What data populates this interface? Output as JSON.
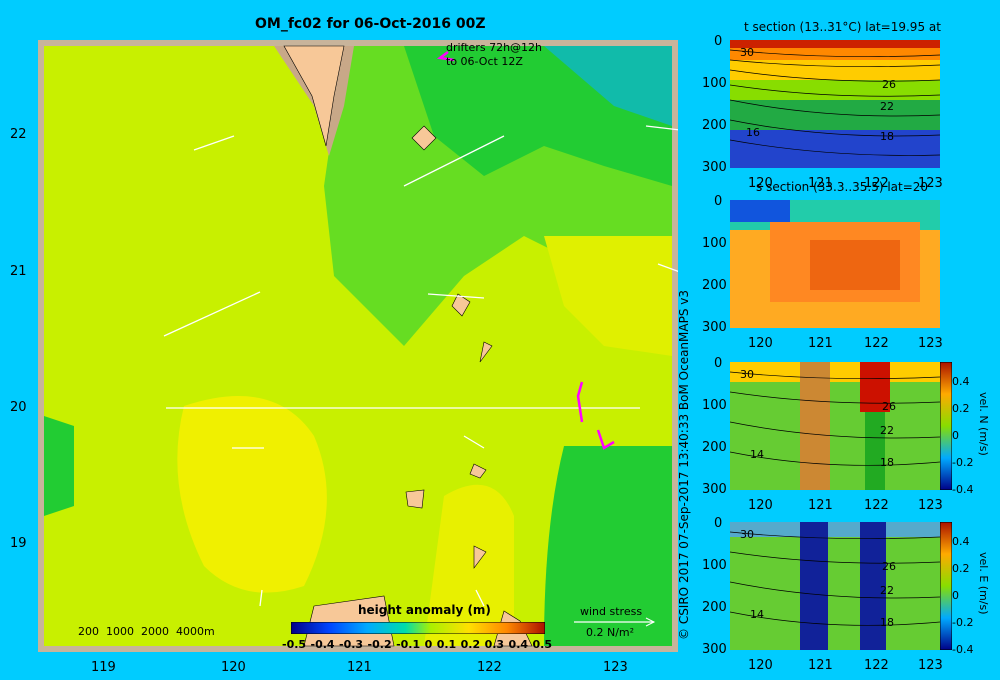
{
  "title": "OM_fc02 for 06-Oct-2016 00Z",
  "drifters": {
    "line1": "drifters 72h@12h",
    "line2": "to 06-Oct 12Z"
  },
  "map": {
    "y_ticks": [
      "22",
      "21",
      "20",
      "19"
    ],
    "x_ticks": [
      "119",
      "120",
      "121",
      "122",
      "123"
    ],
    "depth_legend": "200  1000  2000  4000m",
    "section_line_lat": 20
  },
  "colorbar": {
    "title": "height anomaly (m)",
    "ticks": [
      "-0.5",
      "-0.4",
      "-0.3",
      "-0.2",
      "-0.1",
      "0",
      "0.1",
      "0.2",
      "0.3",
      "0.4",
      "0.5"
    ]
  },
  "wind": {
    "label": "wind stress",
    "unit": "0.2 N/m²"
  },
  "credit": "© CSIRO 2017   07-Sep-2017 13:40:33 BoM OceanMAPS v3",
  "sections": [
    {
      "title": "t section (13..31°C) lat=19.95 at",
      "labels": [
        "30",
        "26",
        "22",
        "18",
        "16"
      ]
    },
    {
      "title": "s section (33.3..35.5) lat=20",
      "labels": []
    },
    {
      "title": "",
      "labels": [
        "30",
        "26",
        "22",
        "18",
        "14"
      ],
      "cb_label": "vel. N (m/s)",
      "cb_ticks": [
        "0.4",
        "0.2",
        "0",
        "-0.2",
        "-0.4"
      ]
    },
    {
      "title": "",
      "labels": [
        "30",
        "26",
        "22",
        "18",
        "14"
      ],
      "cb_label": "vel. E (m/s)",
      "cb_ticks": [
        "0.4",
        "0.2",
        "0",
        "-0.2",
        "-0.4"
      ]
    }
  ],
  "section_axes": {
    "y_ticks": [
      "0",
      "100",
      "200",
      "300"
    ],
    "x_ticks": [
      "120",
      "121",
      "122",
      "123"
    ]
  },
  "colors": {
    "background": "#00ccff",
    "land": "#f7c898",
    "shelf": "#c8a888"
  }
}
